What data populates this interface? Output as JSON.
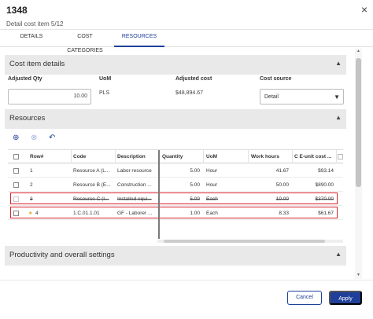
{
  "window": {
    "title": "1348",
    "subtitle": "Detail cost item 5/12",
    "close_glyph": "×"
  },
  "tabs": [
    {
      "label": "DETAILS",
      "active": false
    },
    {
      "label": "COST CATEGORIES",
      "active": false
    },
    {
      "label": "RESOURCES",
      "active": true
    }
  ],
  "cost_item_details": {
    "title": "Cost item details",
    "fields": {
      "adjusted_qty": {
        "label": "Adjusted Qty",
        "value": "10.00"
      },
      "uom": {
        "label": "UoM",
        "value": "PLS"
      },
      "adjusted_cost": {
        "label": "Adjusted cost",
        "value": "$48,894.67"
      },
      "cost_source": {
        "label": "Cost source",
        "value": "Detail"
      }
    }
  },
  "resources": {
    "title": "Resources",
    "toolbar": {
      "add_icon": "add-circle-icon",
      "delete_icon": "remove-circle-icon",
      "undo_icon": "undo-icon"
    },
    "columns": [
      "Row#",
      "Code",
      "Description",
      "Quantity",
      "UoM",
      "Work hours",
      "C E-unit cost ..."
    ],
    "rows": [
      {
        "row": "1",
        "code": "Resource A (L...",
        "description": "Labor resource",
        "quantity": "5.00",
        "uom": "Hour",
        "work_hours": "41.67",
        "unit_cost": "$93.14",
        "struck": false,
        "highlighted": false,
        "starred": false
      },
      {
        "row": "2",
        "code": "Resource B (E...",
        "description": "Construction ...",
        "quantity": "5.00",
        "uom": "Hour",
        "work_hours": "50.00",
        "unit_cost": "$890.00",
        "struck": false,
        "highlighted": false,
        "starred": false
      },
      {
        "row": "3",
        "code": "Resource C (I...",
        "description": "Installed equi...",
        "quantity": "5.00",
        "uom": "Each",
        "work_hours": "10.00",
        "unit_cost": "$370.00",
        "struck": true,
        "highlighted": true,
        "starred": false
      },
      {
        "row": "4",
        "code": "1.C.01.1.01",
        "description": "GF - Laborer ...",
        "quantity": "1.00",
        "uom": "Each",
        "work_hours": "8.33",
        "unit_cost": "$61.67",
        "struck": false,
        "highlighted": true,
        "starred": true
      }
    ],
    "colors": {
      "highlight": "#d9232d",
      "star": "#e4a11b"
    }
  },
  "productivity": {
    "title": "Productivity and overall settings"
  },
  "footer": {
    "cancel_label": "Cancel",
    "apply_label": "Apply"
  },
  "colors": {
    "accent": "#1e3f9a",
    "section_bg": "#e9e9e9"
  }
}
